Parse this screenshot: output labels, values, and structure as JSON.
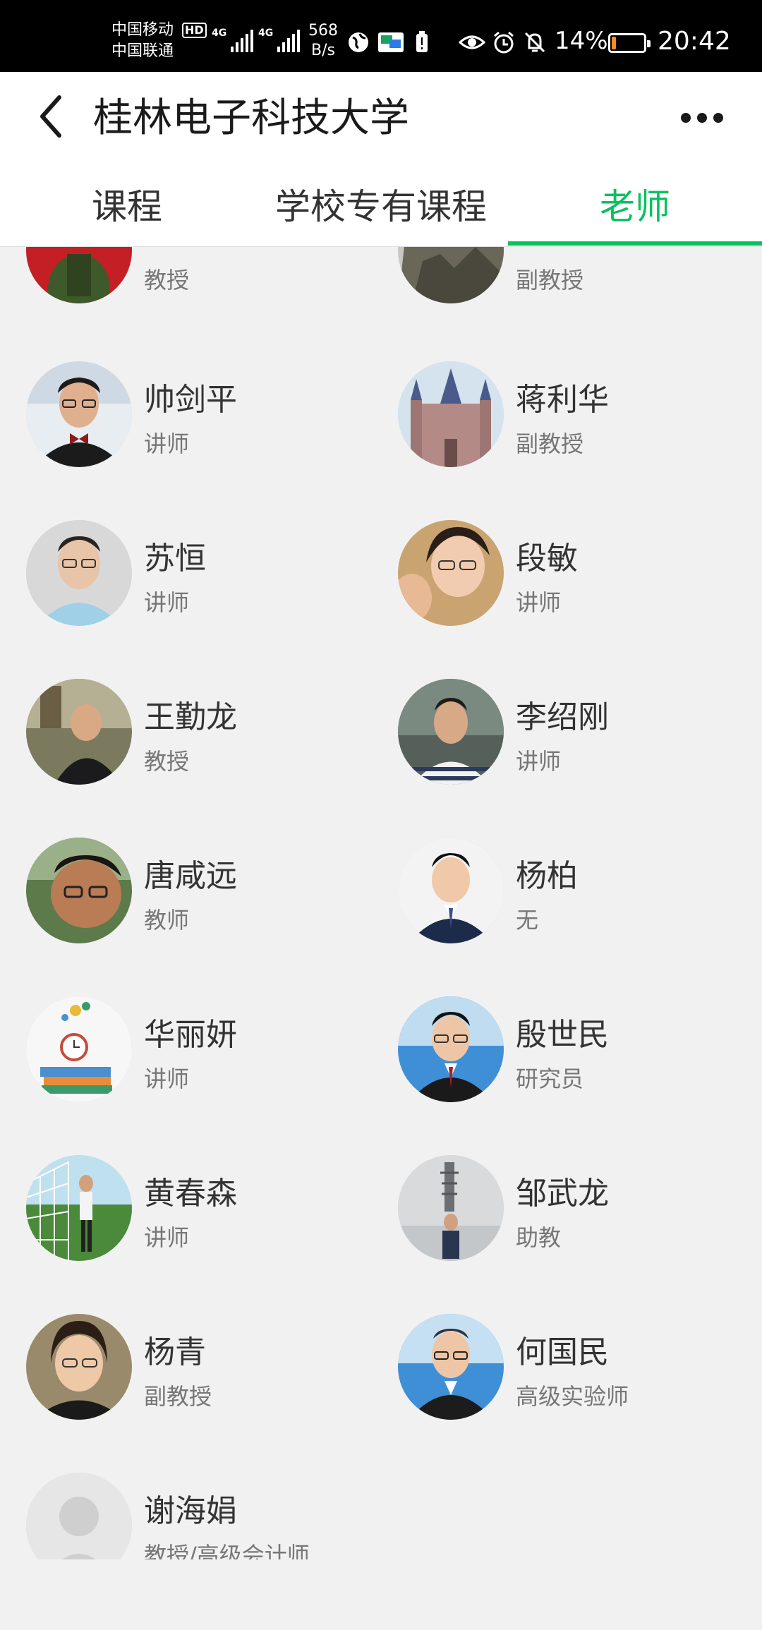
{
  "status_bar": {
    "carrier_1": "中国移动",
    "carrier_2": "中国联通",
    "hd": "HD",
    "net_tag": "4G",
    "speed_value": "568",
    "speed_unit": "B/s",
    "battery_percent": "14%",
    "battery_level": 0.14,
    "time": "20:42"
  },
  "header": {
    "title": "桂林电子科技大学"
  },
  "tabs": [
    {
      "label": "课程"
    },
    {
      "label": "学校专有课程"
    },
    {
      "label": "老师"
    }
  ],
  "active_tab": "老师",
  "accent_color": "#07c160",
  "teachers": [
    {
      "name": "",
      "title": "教授",
      "avatar": "photo-person-red-background"
    },
    {
      "name": "",
      "title": "副教授",
      "avatar": "photo-rock-landscape"
    },
    {
      "name": "帅剑平",
      "title": "讲师",
      "avatar": "photo-man-glasses-bowtie"
    },
    {
      "name": "蒋利华",
      "title": "副教授",
      "avatar": "photo-castle"
    },
    {
      "name": "苏恒",
      "title": "讲师",
      "avatar": "photo-man-glasses"
    },
    {
      "name": "段敏",
      "title": "讲师",
      "avatar": "photo-woman-glasses-child"
    },
    {
      "name": "王勤龙",
      "title": "教授",
      "avatar": "photo-man-dark-jacket"
    },
    {
      "name": "李绍刚",
      "title": "讲师",
      "avatar": "photo-man-striped-shirt"
    },
    {
      "name": "唐咸远",
      "title": "教师",
      "avatar": "photo-man-selfie"
    },
    {
      "name": "杨柏",
      "title": "无",
      "avatar": "photo-man-suit"
    },
    {
      "name": "华丽妍",
      "title": "讲师",
      "avatar": "illustration-books-clock"
    },
    {
      "name": "殷世民",
      "title": "研究员",
      "avatar": "photo-man-suit-blue"
    },
    {
      "name": "黄春森",
      "title": "讲师",
      "avatar": "photo-man-soccer-field"
    },
    {
      "name": "邹武龙",
      "title": "助教",
      "avatar": "photo-man-winter-pagoda"
    },
    {
      "name": "杨青",
      "title": "副教授",
      "avatar": "photo-woman-glasses"
    },
    {
      "name": "何国民",
      "title": "高级实验师",
      "avatar": "photo-man-glasses-suit"
    },
    {
      "name": "谢海娟",
      "title": "教授/高级会计师",
      "avatar": "default-avatar-icon"
    }
  ]
}
